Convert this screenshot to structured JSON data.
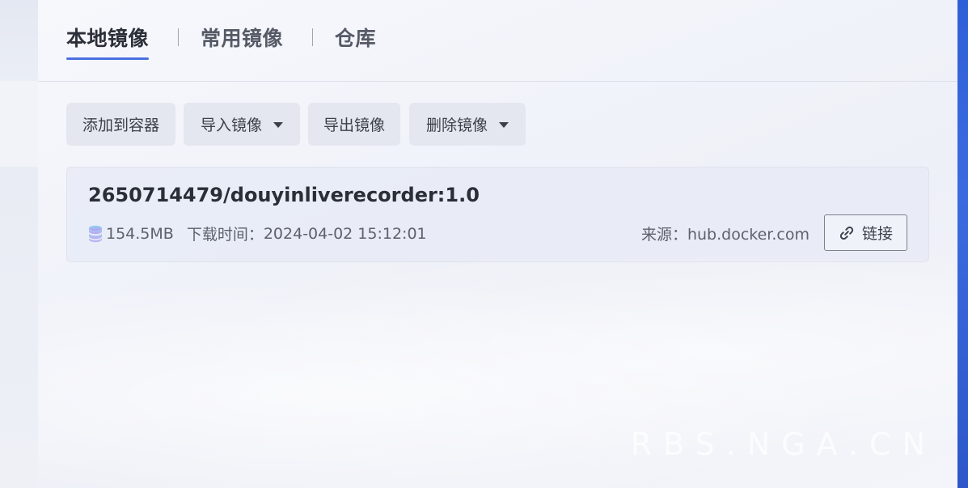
{
  "tabs": [
    {
      "label": "本地镜像",
      "active": true
    },
    {
      "label": "常用镜像",
      "active": false
    },
    {
      "label": "仓库",
      "active": false
    }
  ],
  "toolbar": {
    "add_to_container": "添加到容器",
    "import_image": "导入镜像",
    "export_image": "导出镜像",
    "delete_image": "删除镜像"
  },
  "image": {
    "name": "2650714479/douyinliverecorder:1.0",
    "size": "154.5MB",
    "download_label": "下载时间：",
    "download_time": "2024-04-02 15:12:01",
    "source_label": "来源：",
    "source": "hub.docker.com",
    "link_label": "链接"
  },
  "watermark": "RBS.NGA.CN",
  "colors": {
    "accent": "#4a6fe0",
    "right_edge": "#2f5fd8"
  },
  "icons": {
    "database": "database-icon",
    "link": "link-icon",
    "caret": "caret-down-icon"
  }
}
